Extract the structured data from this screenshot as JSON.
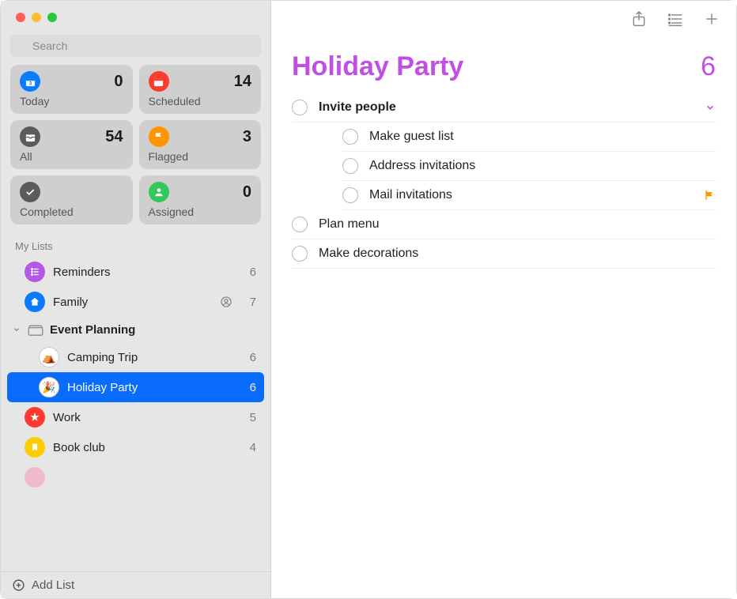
{
  "colors": {
    "accent": "#c14fe6",
    "blue": "#0a7aff",
    "red": "#ff3b30",
    "orange": "#ff9500",
    "green": "#34c759",
    "gray": "#5b5b5b",
    "purpleIcon": "#b558e6",
    "yellow": "#ffcc00"
  },
  "search": {
    "placeholder": "Search"
  },
  "smart": {
    "today": {
      "label": "Today",
      "count": 0,
      "color": "#0a7aff"
    },
    "scheduled": {
      "label": "Scheduled",
      "count": 14,
      "color": "#ff3b30"
    },
    "all": {
      "label": "All",
      "count": 54,
      "color": "#5b5b5b"
    },
    "flagged": {
      "label": "Flagged",
      "count": 3,
      "color": "#ff9500"
    },
    "completed": {
      "label": "Completed",
      "count": "",
      "color": "#5b5b5b"
    },
    "assigned": {
      "label": "Assigned",
      "count": 0,
      "color": "#34c759"
    }
  },
  "sections": {
    "myLists": "My Lists"
  },
  "lists": {
    "reminders": {
      "label": "Reminders",
      "count": 6,
      "color": "#b558e6"
    },
    "family": {
      "label": "Family",
      "count": 7,
      "color": "#0a7aff",
      "shared": true
    },
    "group": {
      "label": "Event Planning"
    },
    "camping": {
      "label": "Camping Trip",
      "count": 6,
      "emoji": "⛺"
    },
    "holiday": {
      "label": "Holiday Party",
      "count": 6,
      "emoji": "🎉"
    },
    "work": {
      "label": "Work",
      "count": 5,
      "color": "#ff3b30"
    },
    "bookclub": {
      "label": "Book club",
      "count": 4,
      "color": "#ffcc00"
    }
  },
  "footer": {
    "addList": "Add List"
  },
  "header": {
    "title": "Holiday Party",
    "count": 6,
    "color": "#c14fe6"
  },
  "reminders": {
    "r0": {
      "title": "Invite people",
      "bold": true,
      "hasChildren": true
    },
    "r1": {
      "title": "Make guest list"
    },
    "r2": {
      "title": "Address invitations"
    },
    "r3": {
      "title": "Mail invitations",
      "flagged": true
    },
    "r4": {
      "title": "Plan menu"
    },
    "r5": {
      "title": "Make decorations"
    }
  }
}
